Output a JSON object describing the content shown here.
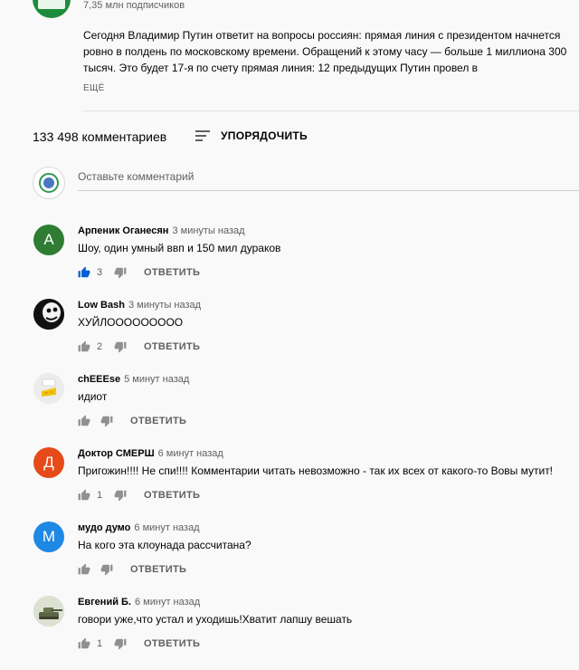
{
  "video": {
    "subscribers": "7,35 млн подписчиков",
    "description": "Сегодня Владимир Путин ответит на вопросы россиян: прямая линия с президентом начнется ровно в полдень по московскому времени. Обращений к этому часу — больше 1 миллиона 300 тысяч. Это будет 17-я по счету прямая линия: 12 предыдущих Путин провел в",
    "more_label": "Ещё"
  },
  "comments_header": {
    "count": "133 498 комментариев",
    "sort_label": "УПОРЯДОЧИТЬ"
  },
  "new_comment": {
    "placeholder": "Оставьте комментарий"
  },
  "comments": [
    {
      "author": "Арпеник Оганесян",
      "time": "3 минуты назад",
      "text": "Шоу, один умный ввп и 150 мил дураков",
      "likes": "3",
      "liked": true,
      "avatar_letter": "А",
      "avatar_color": "#2e7d32"
    },
    {
      "author": "Low Bash",
      "time": "3 минуты назад",
      "text": "ХУЙЛООООООООО",
      "likes": "2",
      "liked": false,
      "avatar_letter": "",
      "avatar_color": "#111111"
    },
    {
      "author": "chEEEse",
      "time": "5 минут назад",
      "text": "идиот",
      "likes": "",
      "liked": false,
      "avatar_letter": "",
      "avatar_color": "#e6e6e6"
    },
    {
      "author": "Доктор СМЕРШ",
      "time": "6 минут назад",
      "text": "Пригожин!!!! Не спи!!!!  Комментарии читать невозможно - так их всех от какого-то Вовы мутит!",
      "likes": "1",
      "liked": false,
      "avatar_letter": "Д",
      "avatar_color": "#e64a19"
    },
    {
      "author": "мудо думо",
      "time": "6 минут назад",
      "text": "На кого эта клоунада рассчитана?",
      "likes": "",
      "liked": false,
      "avatar_letter": "М",
      "avatar_color": "#1e88e5"
    },
    {
      "author": "Евгений Б.",
      "time": "6 минут назад",
      "text": "говори уже,что устал и уходишь!Хватит лапшу вешать",
      "likes": "1",
      "liked": false,
      "avatar_letter": "",
      "avatar_color": "#cfd4c4"
    }
  ],
  "reply_label": "ОТВЕТИТЬ",
  "colors": {
    "like_active": "#065fd4",
    "icon_default": "#909090",
    "secondary_text": "#606060"
  }
}
